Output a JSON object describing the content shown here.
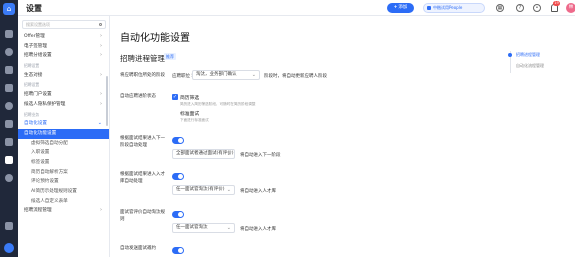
{
  "header": {
    "title": "设置",
    "new_button": "添加",
    "company": "中楷试用People",
    "notification_count": "19",
    "avatar_text": "林"
  },
  "sidebar": {
    "search_placeholder": "搜索设置选项",
    "items": [
      {
        "label": "Offer管理",
        "kind": "item",
        "chevron": "›"
      },
      {
        "label": "电子签管理",
        "kind": "item",
        "chevron": "›"
      },
      {
        "label": "招聘分组设置",
        "kind": "item",
        "chevron": "›"
      },
      {
        "label": "招聘设置",
        "kind": "group"
      },
      {
        "label": "生态对接",
        "kind": "item",
        "chevron": "›"
      },
      {
        "label": "招聘设置",
        "kind": "group"
      },
      {
        "label": "招聘门户设置",
        "kind": "item",
        "chevron": "›"
      },
      {
        "label": "候选人隐私保护管理",
        "kind": "item",
        "chevron": "›"
      },
      {
        "label": "招聘业务",
        "kind": "group"
      },
      {
        "label": "自动化设置",
        "kind": "open",
        "chevron": "⌄"
      },
      {
        "label": "自动化功能设置",
        "kind": "active"
      },
      {
        "label": "虚拟筛选自动分配",
        "kind": "sub"
      },
      {
        "label": "入职设置",
        "kind": "sub"
      },
      {
        "label": "标签设置",
        "kind": "sub"
      },
      {
        "label": "简历自动解析方案",
        "kind": "sub"
      },
      {
        "label": "评论预约设置",
        "kind": "sub"
      },
      {
        "label": "AI简历示处理规则设置",
        "kind": "sub"
      },
      {
        "label": "候选人自定义表单",
        "kind": "sub"
      },
      {
        "label": "招聘流程管理",
        "kind": "item",
        "chevron": "›"
      }
    ]
  },
  "main": {
    "page_title": "自动化功能设置",
    "section_title": "招聘进程管理",
    "section_tag": "推荐",
    "rows": {
      "row1_label": "将应聘职位所处的阶段",
      "row1_prefix": "应聘职位 将",
      "row1_select": "淘汰，业务部门确认",
      "row1_suffix": "阶段时，将自动更新应聘人阶段",
      "row2_label": "自动应聘进阶状态",
      "row2_opt1_label": "简历筛选",
      "row2_opt1_desc": "简历进入简历筛选阶段，可随时在简历阶段调整",
      "row2_opt2_label": "标准面试",
      "row2_opt2_desc": "下面进行标准面试",
      "row3_label": "根据面试结果进入下一阶段自动处理",
      "row3_select": "全部面试者通过面试(有评价)",
      "row3_suffix": "将自动进入下一阶段",
      "row4_label": "根据面试结果进入入才库自动处理",
      "row4_select": "任一面试官淘汰(有评价)",
      "row4_suffix": "将自动进入人才库",
      "row5_label": "面试官评价自动淘汰规则",
      "row5_select": "任一面试官淘汰",
      "row5_suffix": "将自动进入人才库",
      "row6_label": "自动发送面试邀约"
    }
  },
  "anchor_nav": {
    "items": [
      {
        "label": "招聘进程管理",
        "active": true
      },
      {
        "label": "自动化流程管理",
        "active": false
      }
    ]
  },
  "colors": {
    "accent": "#2c6cf6",
    "rail": "#20283a",
    "badge": "#f04a4a",
    "avatar": "#ee6a8b"
  }
}
